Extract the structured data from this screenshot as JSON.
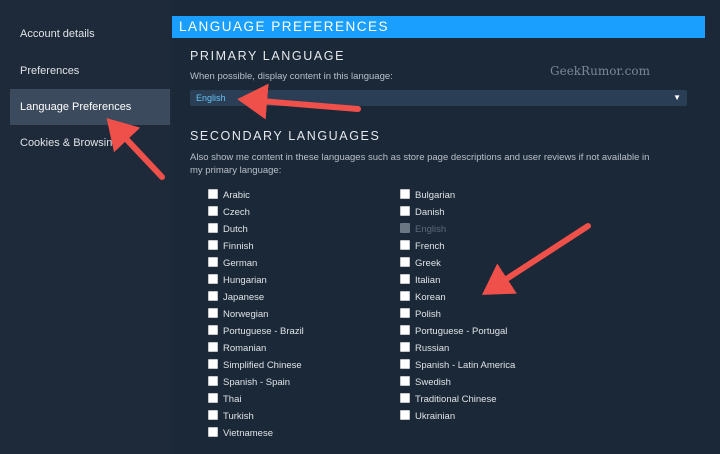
{
  "sidebar": {
    "items": [
      {
        "label": "Account details"
      },
      {
        "label": "Preferences"
      },
      {
        "label": "Language Preferences"
      },
      {
        "label": "Cookies & Browsing"
      }
    ]
  },
  "section_title": "LANGUAGE PREFERENCES",
  "watermark": "GeekRumor.com",
  "primary": {
    "heading": "PRIMARY LANGUAGE",
    "description": "When possible, display content in this language:",
    "selected": "English"
  },
  "secondary": {
    "heading": "SECONDARY LANGUAGES",
    "description": "Also show me content in these languages such as store page descriptions and user reviews if not available in my primary language:",
    "left_column": [
      "Arabic",
      "Czech",
      "Dutch",
      "Finnish",
      "German",
      "Hungarian",
      "Japanese",
      "Norwegian",
      "Portuguese - Brazil",
      "Romanian",
      "Simplified Chinese",
      "Spanish - Spain",
      "Thai",
      "Turkish",
      "Vietnamese"
    ],
    "right_column": [
      "Bulgarian",
      "Danish",
      "English",
      "French",
      "Greek",
      "Italian",
      "Korean",
      "Polish",
      "Portuguese - Portugal",
      "Russian",
      "Spanish - Latin America",
      "Swedish",
      "Traditional Chinese",
      "Ukrainian"
    ],
    "disabled": "English"
  },
  "colors": {
    "accent": "#1a9fff",
    "arrow": "#f0504a",
    "background": "#1b2838"
  },
  "icons": {
    "dropdown": "caret-down-icon",
    "annotation": "arrow-icon"
  }
}
